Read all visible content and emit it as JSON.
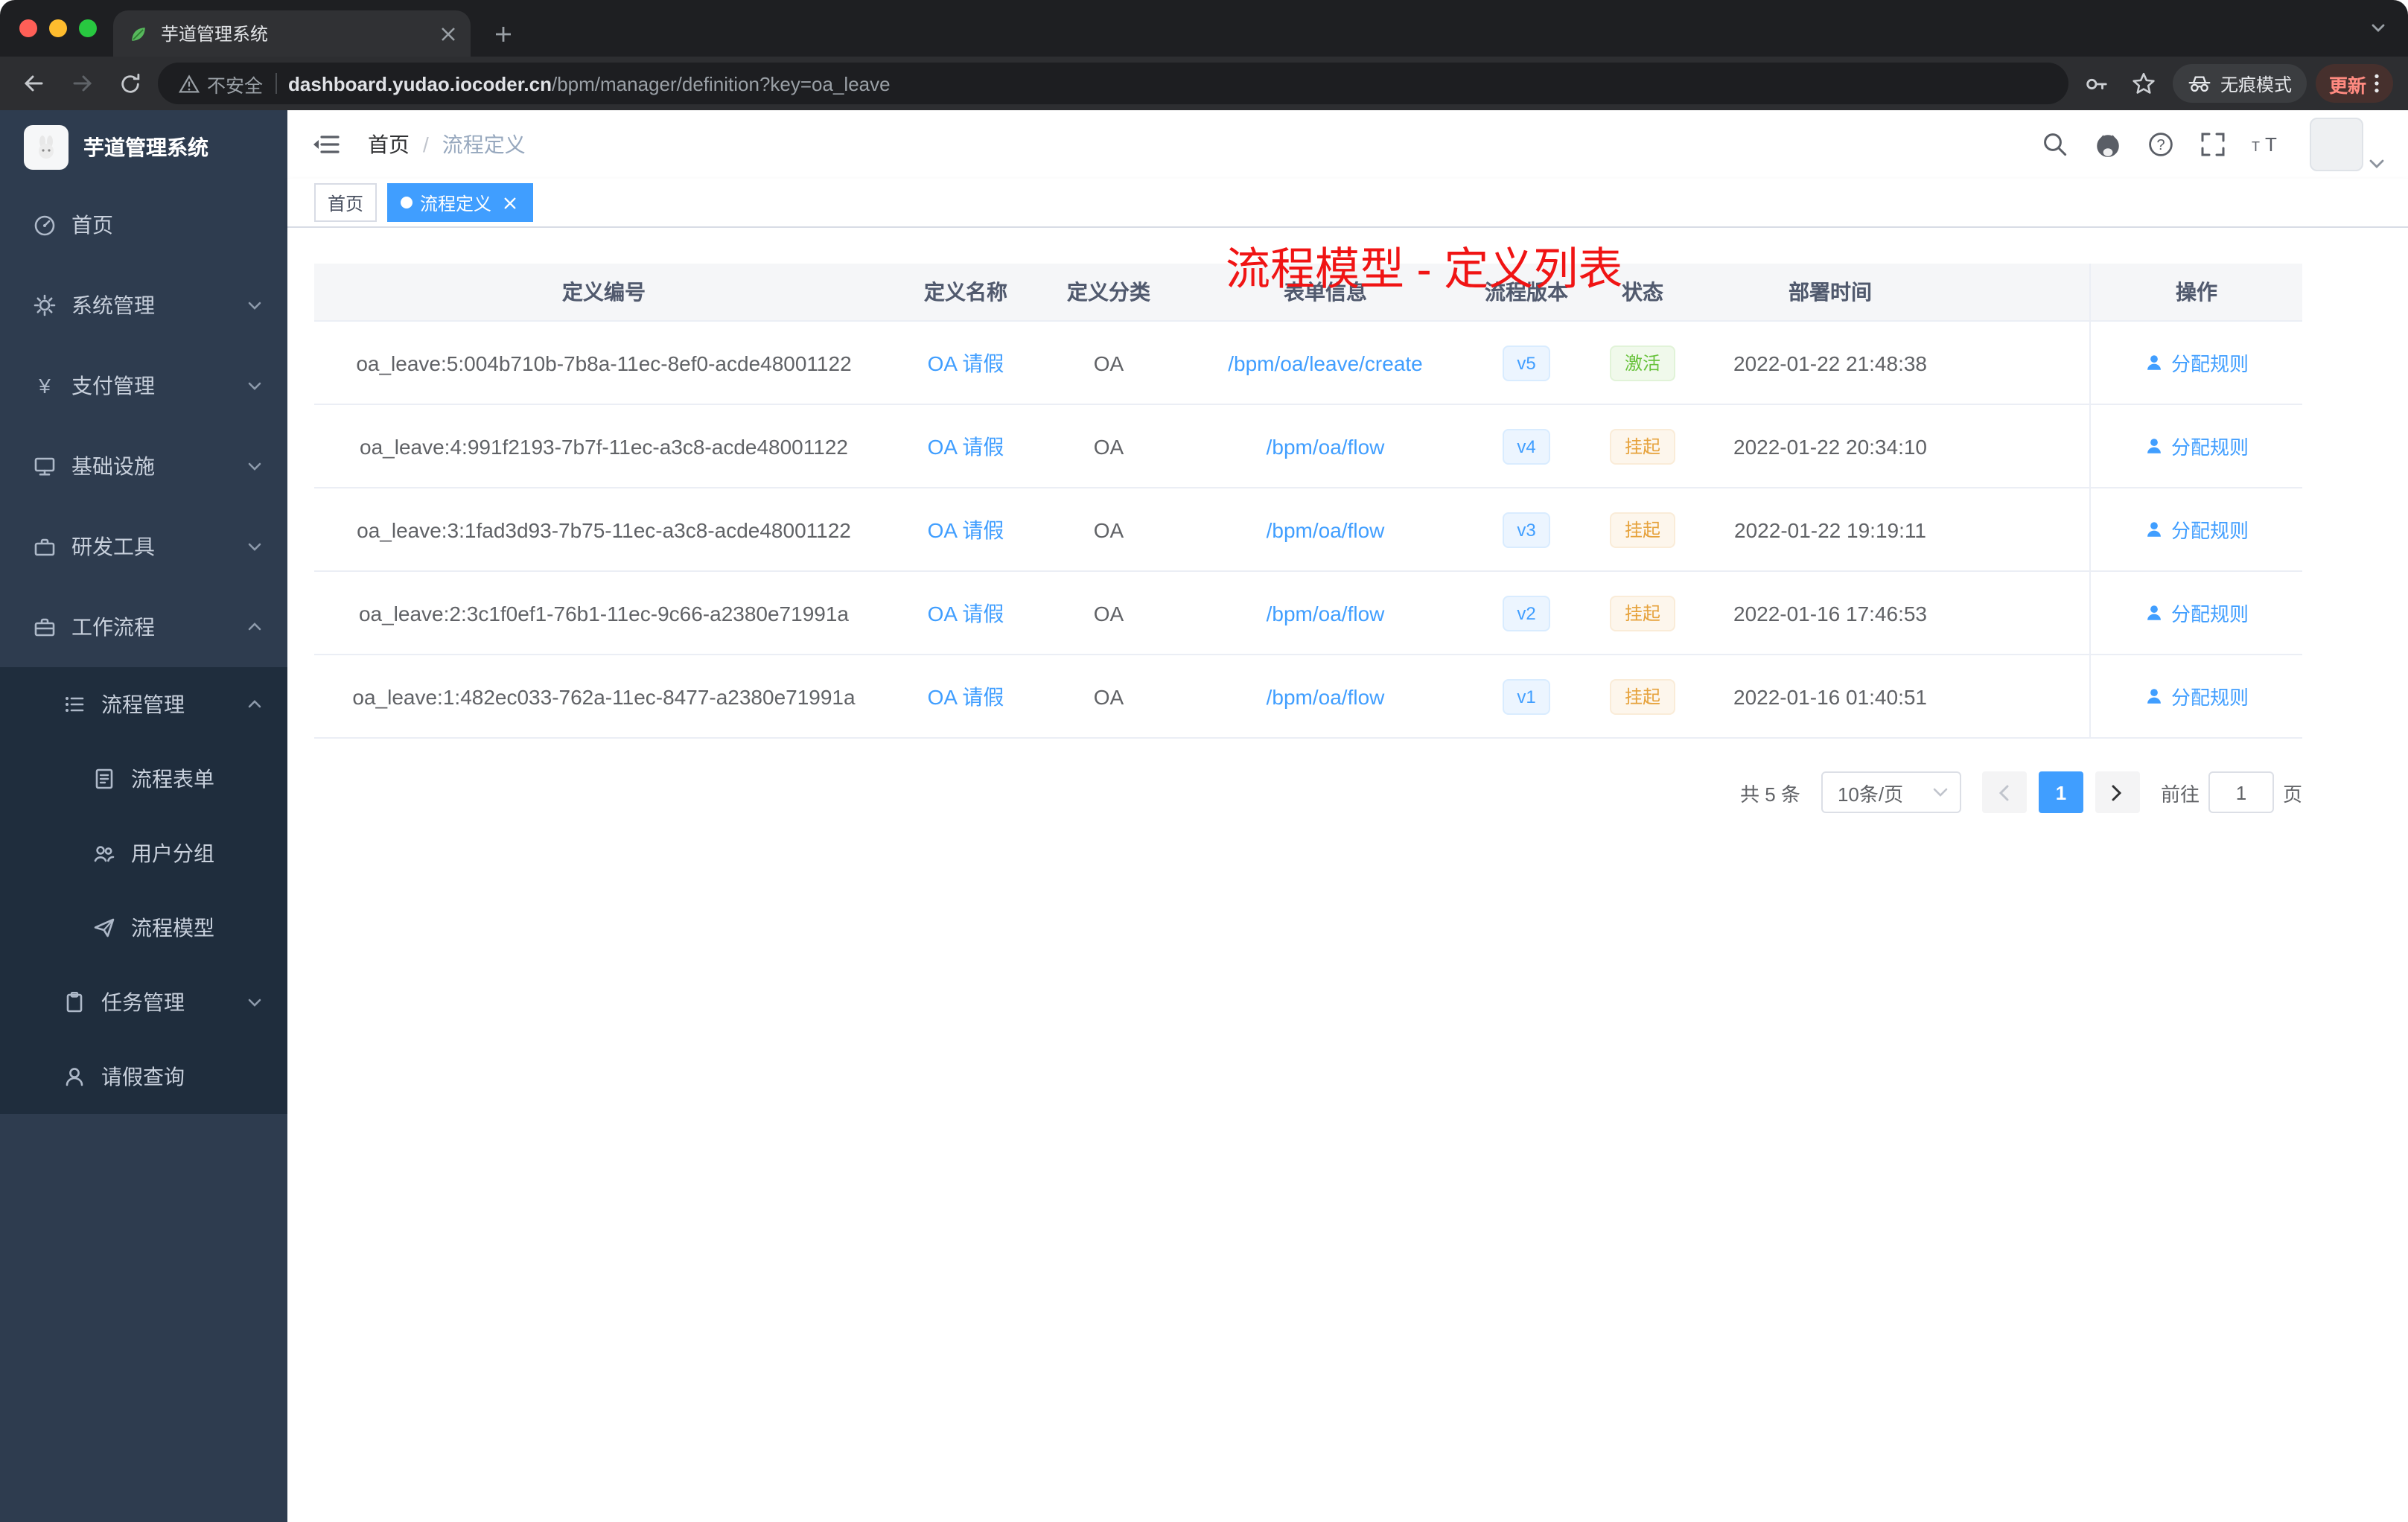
{
  "browser": {
    "tab_title": "芋道管理系统",
    "security_label": "不安全",
    "url_host": "dashboard.yudao.iocoder.cn",
    "url_path": "/bpm/manager/definition?key=oa_leave",
    "incognito_label": "无痕模式",
    "update_label": "更新"
  },
  "sidebar": {
    "app_title": "芋道管理系统",
    "items": [
      {
        "label": "首页"
      },
      {
        "label": "系统管理"
      },
      {
        "label": "支付管理"
      },
      {
        "label": "基础设施"
      },
      {
        "label": "研发工具"
      },
      {
        "label": "工作流程"
      },
      {
        "label": "流程管理"
      },
      {
        "label": "流程表单"
      },
      {
        "label": "用户分组"
      },
      {
        "label": "流程模型"
      },
      {
        "label": "任务管理"
      },
      {
        "label": "请假查询"
      }
    ]
  },
  "navbar": {
    "breadcrumb_home": "首页",
    "breadcrumb_sep": "/",
    "breadcrumb_current": "流程定义"
  },
  "overlay_title": "流程模型 - 定义列表",
  "tags": {
    "home": "首页",
    "current": "流程定义"
  },
  "table": {
    "columns": [
      "定义编号",
      "定义名称",
      "定义分类",
      "表单信息",
      "流程版本",
      "状态",
      "部署时间",
      "操作"
    ],
    "rows": [
      {
        "id": "oa_leave:5:004b710b-7b8a-11ec-8ef0-acde48001122",
        "name": "OA 请假",
        "category": "OA",
        "form": "/bpm/oa/leave/create",
        "version": "v5",
        "status": "激活",
        "status_type": "success",
        "time": "2022-01-22 21:48:38",
        "action": "分配规则"
      },
      {
        "id": "oa_leave:4:991f2193-7b7f-11ec-a3c8-acde48001122",
        "name": "OA 请假",
        "category": "OA",
        "form": "/bpm/oa/flow",
        "version": "v4",
        "status": "挂起",
        "status_type": "warning",
        "time": "2022-01-22 20:34:10",
        "action": "分配规则"
      },
      {
        "id": "oa_leave:3:1fad3d93-7b75-11ec-a3c8-acde48001122",
        "name": "OA 请假",
        "category": "OA",
        "form": "/bpm/oa/flow",
        "version": "v3",
        "status": "挂起",
        "status_type": "warning",
        "time": "2022-01-22 19:19:11",
        "action": "分配规则"
      },
      {
        "id": "oa_leave:2:3c1f0ef1-76b1-11ec-9c66-a2380e71991a",
        "name": "OA 请假",
        "category": "OA",
        "form": "/bpm/oa/flow",
        "version": "v2",
        "status": "挂起",
        "status_type": "warning",
        "time": "2022-01-16 17:46:53",
        "action": "分配规则"
      },
      {
        "id": "oa_leave:1:482ec033-762a-11ec-8477-a2380e71991a",
        "name": "OA 请假",
        "category": "OA",
        "form": "/bpm/oa/flow",
        "version": "v1",
        "status": "挂起",
        "status_type": "warning",
        "time": "2022-01-16 01:40:51",
        "action": "分配规则"
      }
    ]
  },
  "pagination": {
    "total": "共 5 条",
    "page_size": "10条/页",
    "current": "1",
    "goto_label": "前往",
    "goto_value": "1",
    "goto_unit": "页"
  }
}
